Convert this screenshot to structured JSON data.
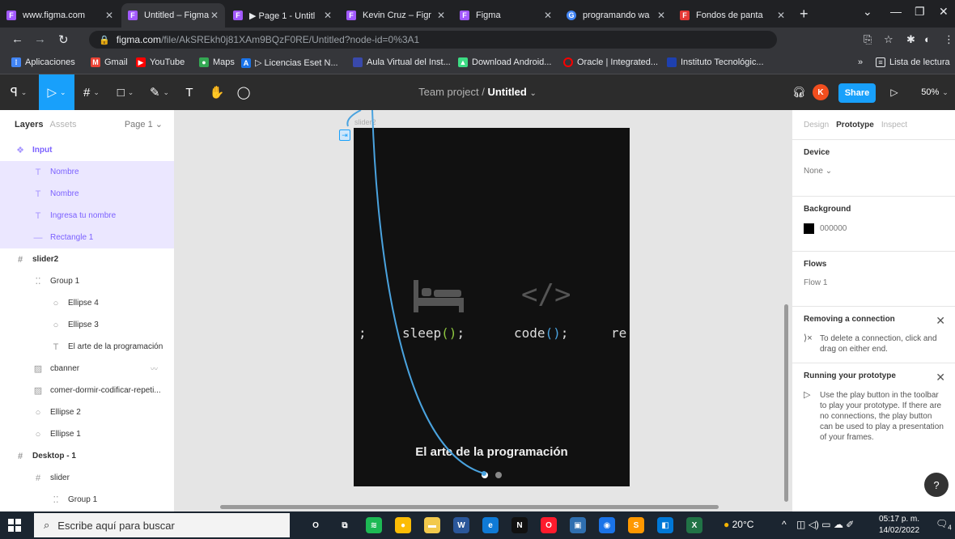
{
  "browser": {
    "tabs": [
      {
        "title": "www.figma.com",
        "favicon": "figma-icon",
        "color": "#a259ff"
      },
      {
        "title": "Untitled – Figma",
        "favicon": "figma-icon",
        "color": "#a259ff"
      },
      {
        "title": "▶ Page 1 - Untitl",
        "favicon": "figma-icon",
        "color": "#a259ff"
      },
      {
        "title": "Kevin Cruz – Figr",
        "favicon": "figma-icon",
        "color": "#a259ff"
      },
      {
        "title": "Figma",
        "favicon": "figma-icon",
        "color": "#a259ff"
      },
      {
        "title": "programando wa",
        "favicon": "google-icon",
        "color": "#4285f4"
      },
      {
        "title": "Fondos de panta",
        "favicon": "fondos-icon",
        "color": "#e53935"
      }
    ],
    "url_host": "figma.com",
    "url_path": "/file/AkSREkh0j81XAm9BQzF0RE/Untitled?node-id=0%3A1",
    "bookmarks": [
      {
        "label": "Aplicaciones",
        "color": "#4285f4"
      },
      {
        "label": "Gmail",
        "color": "#ea4335"
      },
      {
        "label": "YouTube",
        "color": "#ff0000"
      },
      {
        "label": "Maps",
        "color": "#34a853"
      },
      {
        "label": "▷ Licencias Eset N...",
        "color": "#1a73e8"
      },
      {
        "label": "Aula Virtual del Inst...",
        "color": "#3949ab"
      },
      {
        "label": "Download Android...",
        "color": "#3ddc84"
      },
      {
        "label": "Oracle | Integrated...",
        "color": "#f80000"
      },
      {
        "label": "Instituto Tecnológic...",
        "color": "#1e40af"
      }
    ],
    "reading_list": "Lista de lectura",
    "more_bookmarks": "»"
  },
  "figma": {
    "team": "Team project",
    "separator": "/",
    "file_title": "Untitled",
    "share_label": "Share",
    "avatar_letter": "K",
    "zoom": "50%",
    "accent": "#18a0fb"
  },
  "left_panel": {
    "tab_layers": "Layers",
    "tab_assets": "Assets",
    "page": "Page 1",
    "layers": [
      {
        "name": "Input",
        "icon": "component-icon",
        "indent": 0,
        "purple": true,
        "selected": false,
        "bold": true
      },
      {
        "name": "Nombre",
        "icon": "text-icon",
        "indent": 1,
        "purple": true,
        "selected": true,
        "bold": false
      },
      {
        "name": "Nombre",
        "icon": "text-icon",
        "indent": 1,
        "purple": true,
        "selected": true,
        "bold": false
      },
      {
        "name": "Ingresa tu nombre",
        "icon": "text-icon",
        "indent": 1,
        "purple": true,
        "selected": true,
        "bold": false
      },
      {
        "name": "Rectangle 1",
        "icon": "line-icon",
        "indent": 1,
        "purple": true,
        "selected": true,
        "bold": false
      },
      {
        "name": "slider2",
        "icon": "frame-icon",
        "indent": 0,
        "purple": false,
        "selected": false,
        "bold": true
      },
      {
        "name": "Group 1",
        "icon": "group-icon",
        "indent": 1,
        "purple": false,
        "selected": false,
        "bold": false
      },
      {
        "name": "Ellipse 4",
        "icon": "ellipse-icon",
        "indent": 2,
        "purple": false,
        "selected": false,
        "bold": false
      },
      {
        "name": "Ellipse 3",
        "icon": "ellipse-icon",
        "indent": 2,
        "purple": false,
        "selected": false,
        "bold": false
      },
      {
        "name": "El arte de la programación",
        "icon": "text-icon",
        "indent": 2,
        "purple": false,
        "selected": false,
        "bold": false
      },
      {
        "name": "cbanner",
        "icon": "image-icon",
        "indent": 1,
        "purple": false,
        "selected": false,
        "bold": false
      },
      {
        "name": "comer-dormir-codificar-repeti...",
        "icon": "image-icon",
        "indent": 1,
        "purple": false,
        "selected": false,
        "bold": false
      },
      {
        "name": "Ellipse 2",
        "icon": "ellipse-icon",
        "indent": 1,
        "purple": false,
        "selected": false,
        "bold": false
      },
      {
        "name": "Ellipse 1",
        "icon": "ellipse-icon",
        "indent": 1,
        "purple": false,
        "selected": false,
        "bold": false
      },
      {
        "name": "Desktop - 1",
        "icon": "frame-icon",
        "indent": 0,
        "purple": false,
        "selected": false,
        "bold": true
      },
      {
        "name": "slider",
        "icon": "frame-icon",
        "indent": 1,
        "purple": false,
        "selected": false,
        "bold": false
      },
      {
        "name": "Group 1",
        "icon": "group-icon",
        "indent": 2,
        "purple": false,
        "selected": false,
        "bold": false
      }
    ]
  },
  "canvas": {
    "frame_name": "slider2",
    "code_semicolon": ";",
    "code_sleep": "sleep",
    "code_code": "code",
    "code_paren": "()",
    "code_end": ";",
    "code_re": "re",
    "code_icon_text": "</>",
    "caption": "El arte de la programación",
    "dots": [
      {
        "active": true,
        "color": "#ffffff"
      },
      {
        "active": false,
        "color": "#888888"
      }
    ]
  },
  "right_panel": {
    "tabs": [
      "Design",
      "Prototype",
      "Inspect"
    ],
    "active_tab": "Prototype",
    "device_title": "Device",
    "device_value": "None",
    "background_title": "Background",
    "background_value": "000000",
    "flows_title": "Flows",
    "flow_value": "Flow 1",
    "removing_title": "Removing a connection",
    "removing_text": "To delete a connection, click and drag on either end.",
    "running_title": "Running your prototype",
    "running_text": "Use the play button in the toolbar to play your prototype. If there are no connections, the play button can be used to play a presentation of your frames.",
    "help": "?"
  },
  "taskbar": {
    "search_placeholder": "Escribe aquí para buscar",
    "weather": "20°C",
    "time": "05:17 p. m.",
    "date": "14/02/2022",
    "notifications": "4",
    "apps": [
      {
        "name": "cortana-icon",
        "color": "#1b2530",
        "glyph": "O"
      },
      {
        "name": "task-view-icon",
        "color": "#1b2530",
        "glyph": "⧉"
      },
      {
        "name": "spotify-icon",
        "color": "#1db954",
        "glyph": "≋"
      },
      {
        "name": "chrome-icon",
        "color": "#fbbc05",
        "glyph": "●"
      },
      {
        "name": "file-explorer-icon",
        "color": "#f2c94c",
        "glyph": "▬"
      },
      {
        "name": "word-icon",
        "color": "#2b579a",
        "glyph": "W"
      },
      {
        "name": "edge-icon",
        "color": "#0f7ad6",
        "glyph": "e"
      },
      {
        "name": "netflix-icon",
        "color": "#111111",
        "glyph": "N"
      },
      {
        "name": "opera-icon",
        "color": "#ff1b2d",
        "glyph": "O"
      },
      {
        "name": "virtualbox-icon",
        "color": "#2f6fb0",
        "glyph": "▣"
      },
      {
        "name": "app-icon",
        "color": "#1a73e8",
        "glyph": "◉"
      },
      {
        "name": "sublime-icon",
        "color": "#ff9800",
        "glyph": "S"
      },
      {
        "name": "vscode-icon",
        "color": "#0078d7",
        "glyph": "◧"
      },
      {
        "name": "excel-icon",
        "color": "#217346",
        "glyph": "X"
      }
    ]
  }
}
